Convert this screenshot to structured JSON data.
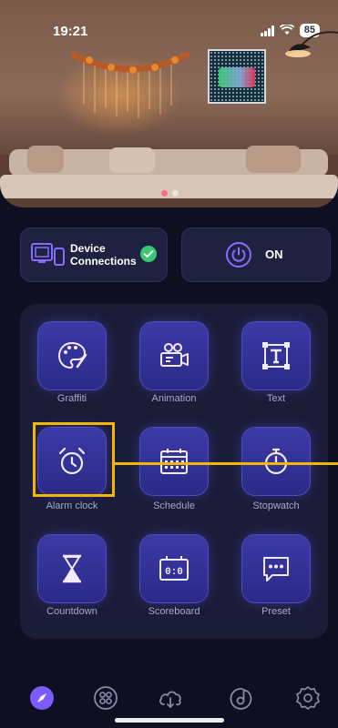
{
  "status_bar": {
    "time": "19:21",
    "battery": "85"
  },
  "hero": {
    "pages": 2,
    "active_page": 1
  },
  "device_card": {
    "label_line1": "Device",
    "label_line2": "Connections",
    "connected": true
  },
  "power_card": {
    "label": "ON"
  },
  "features": [
    {
      "label": "Graffiti",
      "icon": "palette-icon"
    },
    {
      "label": "Animation",
      "icon": "video-camera-icon"
    },
    {
      "label": "Text",
      "icon": "text-box-icon"
    },
    {
      "label": "Alarm clock",
      "icon": "alarm-clock-icon"
    },
    {
      "label": "Schedule",
      "icon": "calendar-icon"
    },
    {
      "label": "Stopwatch",
      "icon": "stopwatch-icon"
    },
    {
      "label": "Countdown",
      "icon": "hourglass-icon"
    },
    {
      "label": "Scoreboard",
      "icon": "scoreboard-icon",
      "display": "0:0"
    },
    {
      "label": "Preset",
      "icon": "chat-bubble-icon"
    }
  ],
  "bottom_nav": [
    {
      "icon": "compass-icon",
      "active": true
    },
    {
      "icon": "grid-apps-icon",
      "active": false
    },
    {
      "icon": "cloud-icon",
      "active": false
    },
    {
      "icon": "music-note-icon",
      "active": false
    },
    {
      "icon": "settings-icon",
      "active": false
    }
  ],
  "colors": {
    "background": "#0e1022",
    "tile": "#3c3aa6",
    "accent": "#7b5cff",
    "highlight": "#f2b705",
    "check": "#37c86f"
  }
}
